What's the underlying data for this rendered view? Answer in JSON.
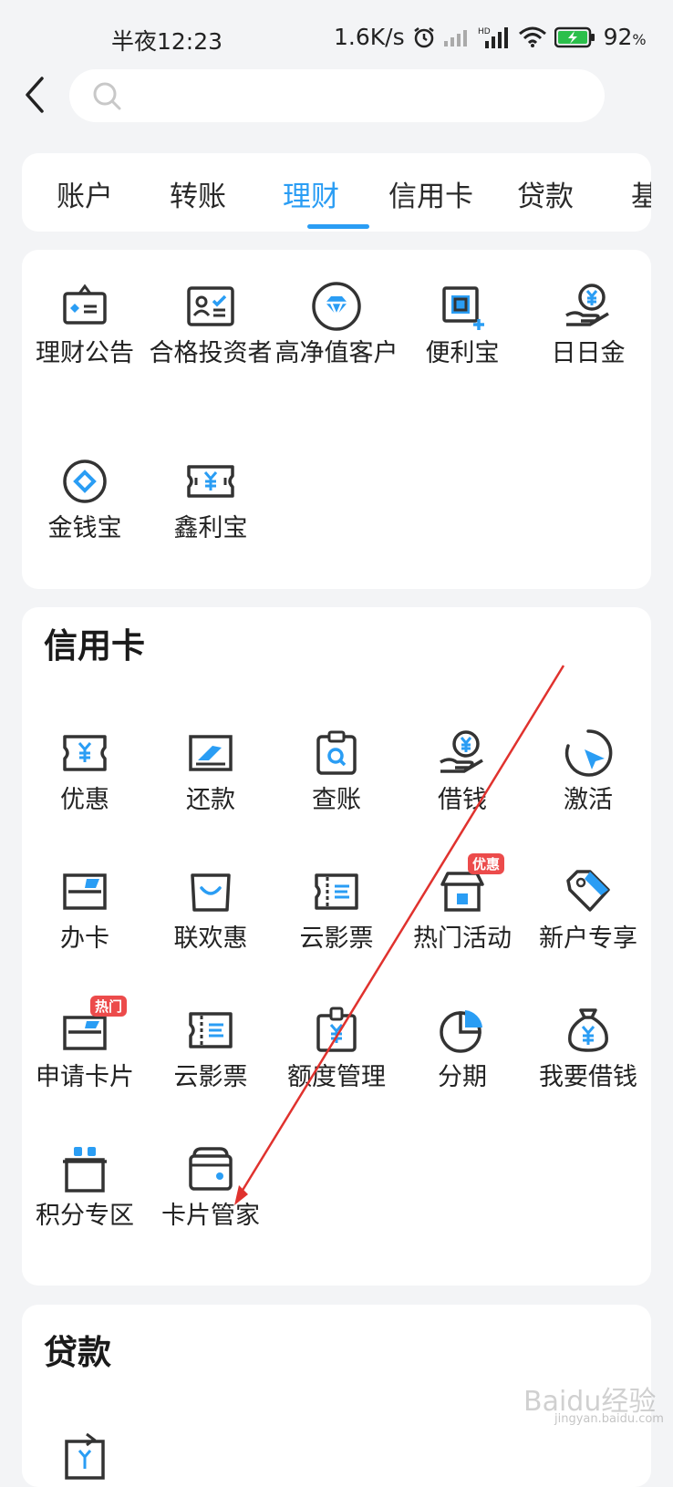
{
  "status": {
    "time": "半夜12:23",
    "speed": "1.6K/s",
    "battery": "92",
    "battery_unit": "%"
  },
  "search": {
    "placeholder": ""
  },
  "tabs": [
    {
      "label": "账户",
      "active": false
    },
    {
      "label": "转账",
      "active": false
    },
    {
      "label": "理财",
      "active": true
    },
    {
      "label": "信用卡",
      "active": false
    },
    {
      "label": "贷款",
      "active": false
    },
    {
      "label": "基",
      "active": false
    }
  ],
  "wealth": {
    "items": [
      {
        "label": "理财公告",
        "icon": "announcement-icon"
      },
      {
        "label": "合格投资者",
        "icon": "investor-id-icon"
      },
      {
        "label": "高净值客户",
        "icon": "diamond-icon"
      },
      {
        "label": "便利宝",
        "icon": "convenience-icon"
      },
      {
        "label": "日日金",
        "icon": "yen-hand-icon"
      },
      {
        "label": "金钱宝",
        "icon": "coin-icon"
      },
      {
        "label": "鑫利宝",
        "icon": "yen-ticket-icon"
      }
    ]
  },
  "credit": {
    "title": "信用卡",
    "items": [
      {
        "label": "优惠",
        "icon": "discount-ticket-icon",
        "badge": ""
      },
      {
        "label": "还款",
        "icon": "repay-icon",
        "badge": ""
      },
      {
        "label": "查账",
        "icon": "check-bill-icon",
        "badge": ""
      },
      {
        "label": "借钱",
        "icon": "borrow-icon",
        "badge": ""
      },
      {
        "label": "激活",
        "icon": "activate-icon",
        "badge": ""
      },
      {
        "label": "办卡",
        "icon": "apply-card-icon",
        "badge": ""
      },
      {
        "label": "联欢惠",
        "icon": "shopping-bag-icon",
        "badge": ""
      },
      {
        "label": "云影票",
        "icon": "movie-ticket-icon",
        "badge": ""
      },
      {
        "label": "热门活动",
        "icon": "store-icon",
        "badge": "优惠"
      },
      {
        "label": "新户专享",
        "icon": "tag-icon",
        "badge": ""
      },
      {
        "label": "申请卡片",
        "icon": "card-icon",
        "badge": "热门"
      },
      {
        "label": "云影票",
        "icon": "movie-ticket-icon",
        "badge": ""
      },
      {
        "label": "额度管理",
        "icon": "limit-icon",
        "badge": ""
      },
      {
        "label": "分期",
        "icon": "pie-icon",
        "badge": ""
      },
      {
        "label": "我要借钱",
        "icon": "money-bag-icon",
        "badge": ""
      },
      {
        "label": "积分专区",
        "icon": "gift-icon",
        "badge": ""
      },
      {
        "label": "卡片管家",
        "icon": "wallet-icon",
        "badge": ""
      }
    ]
  },
  "loan": {
    "title": "贷款"
  },
  "watermark": {
    "text": "Baidu经验",
    "sub": "jingyan.baidu.com"
  },
  "colors": {
    "accent": "#2a9df4",
    "badge": "#ec4b4b",
    "icon": "#333333"
  }
}
